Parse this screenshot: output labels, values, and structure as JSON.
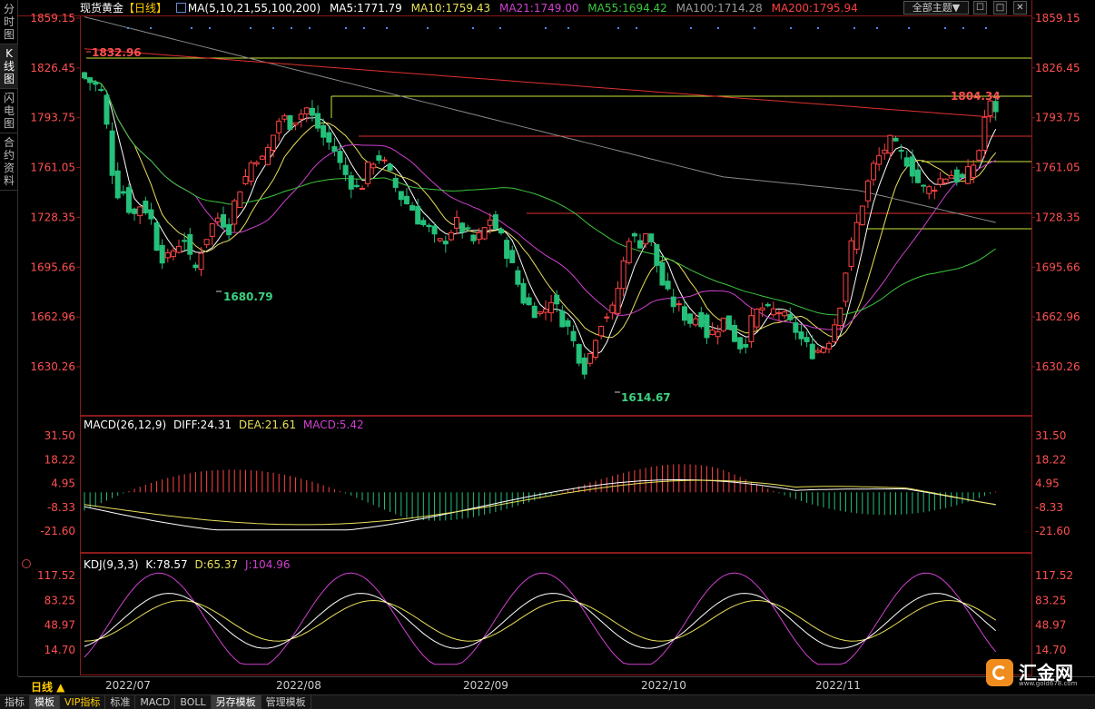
{
  "left_nav": [
    {
      "label": "分时图",
      "active": false
    },
    {
      "label": "K线图",
      "active": true
    },
    {
      "label": "闪电图",
      "active": false
    },
    {
      "label": "合约资料",
      "active": false
    }
  ],
  "header": {
    "instrument": "现货黄金",
    "period_tag": "【日线】",
    "ma_label": "MA(5,10,21,55,100,200)",
    "ma5": "MA5:1771.79",
    "ma10": "MA10:1759.43",
    "ma21": "MA21:1749.00",
    "ma55": "MA55:1694.42",
    "ma100": "MA100:1714.28",
    "ma200": "MA200:1795.94",
    "theme_button": "全部主题▼",
    "window_buttons": [
      "☐",
      "□",
      "✕"
    ]
  },
  "price_axis": [
    "1859.15",
    "1826.45",
    "1793.75",
    "1761.05",
    "1728.35",
    "1695.66",
    "1662.96",
    "1630.26"
  ],
  "price_annotations": {
    "high_start": "1832.96",
    "low_july": "1680.79",
    "low_sept": "1614.67",
    "last_high": "1804.34"
  },
  "macd": {
    "label": "MACD(26,12,9)",
    "diff": "DIFF:24.31",
    "dea": "DEA:21.61",
    "macd": "MACD:5.42",
    "axis": [
      "31.50",
      "18.22",
      "4.95",
      "-8.33",
      "-21.60"
    ]
  },
  "kdj": {
    "label": "KDJ(9,3,3)",
    "k": "K:78.57",
    "d": "D:65.37",
    "j": "J:104.96",
    "axis": [
      "117.52",
      "83.25",
      "48.97",
      "14.70"
    ]
  },
  "dates": [
    "2022/07",
    "2022/08",
    "2022/09",
    "2022/10",
    "2022/11"
  ],
  "period_button": "日线 ▲",
  "bottom_tabs": [
    {
      "label": "指标",
      "active": false,
      "vip": false
    },
    {
      "label": "模板",
      "active": true,
      "vip": false
    },
    {
      "label": "VIP指标",
      "active": false,
      "vip": true
    },
    {
      "label": "标准",
      "active": false,
      "vip": false
    },
    {
      "label": "MACD",
      "active": false,
      "vip": false
    },
    {
      "label": "BOLL",
      "active": false,
      "vip": false
    },
    {
      "label": "另存模板",
      "active": true,
      "vip": false
    },
    {
      "label": "管理模板",
      "active": false,
      "vip": false
    }
  ],
  "logo": {
    "text": "汇金网",
    "url": "www.gold678.com"
  },
  "colors": {
    "up": "#ff4444",
    "down": "#25c07a",
    "ma5": "#ffffff",
    "ma10": "#e8e05a",
    "ma21": "#d040d0",
    "ma55": "#3cc83c",
    "ma100": "#8a8a8a",
    "ma200": "#e03030",
    "axis_text": "#ff5050"
  }
}
